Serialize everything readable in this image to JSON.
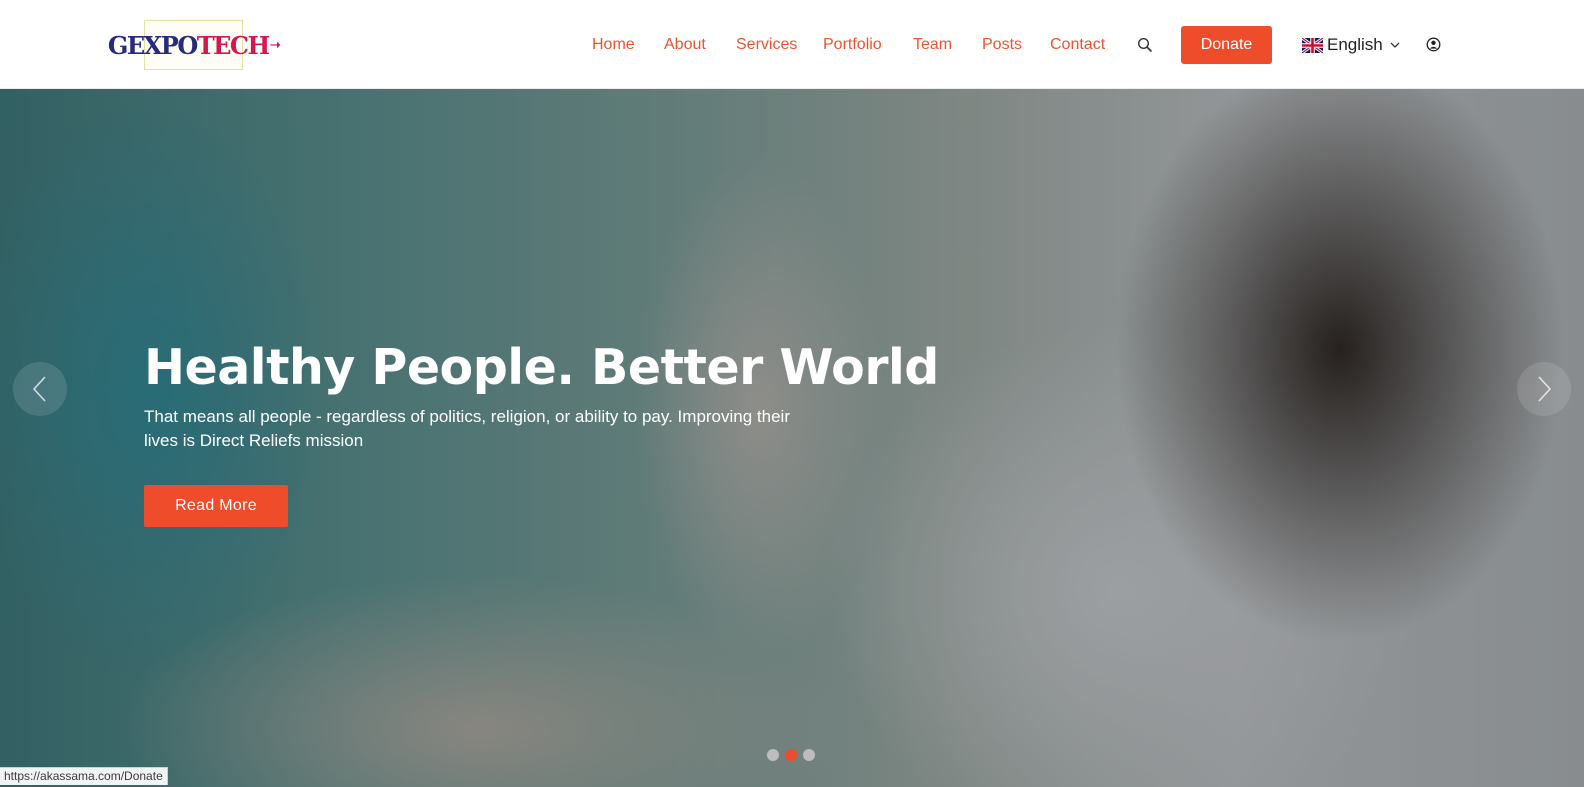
{
  "header": {
    "logo": {
      "part1": "GEXPO",
      "part2": "TECH"
    },
    "nav": [
      {
        "label": "Home"
      },
      {
        "label": "About"
      },
      {
        "label": "Services"
      },
      {
        "label": "Portfolio"
      },
      {
        "label": "Team"
      },
      {
        "label": "Posts"
      },
      {
        "label": "Contact"
      }
    ],
    "search_icon": "search-icon",
    "donate_label": "Donate",
    "language": {
      "label": "English",
      "flag": "uk-flag-icon"
    },
    "user_icon": "user-circle-icon"
  },
  "hero": {
    "title": "Healthy People. Better World",
    "subtitle": "That means all people - regardless of politics, religion, or ability to pay. Improving their lives is Direct Reliefs mission",
    "cta_label": "Read More",
    "slides_total": 3,
    "active_slide": 2
  },
  "status_bar": {
    "url": "https://akassama.com/Donate"
  },
  "colors": {
    "accent": "#ee4c2a",
    "nav_text": "#ef5430",
    "logo_blue": "#272b7e",
    "logo_red": "#d6174f"
  }
}
